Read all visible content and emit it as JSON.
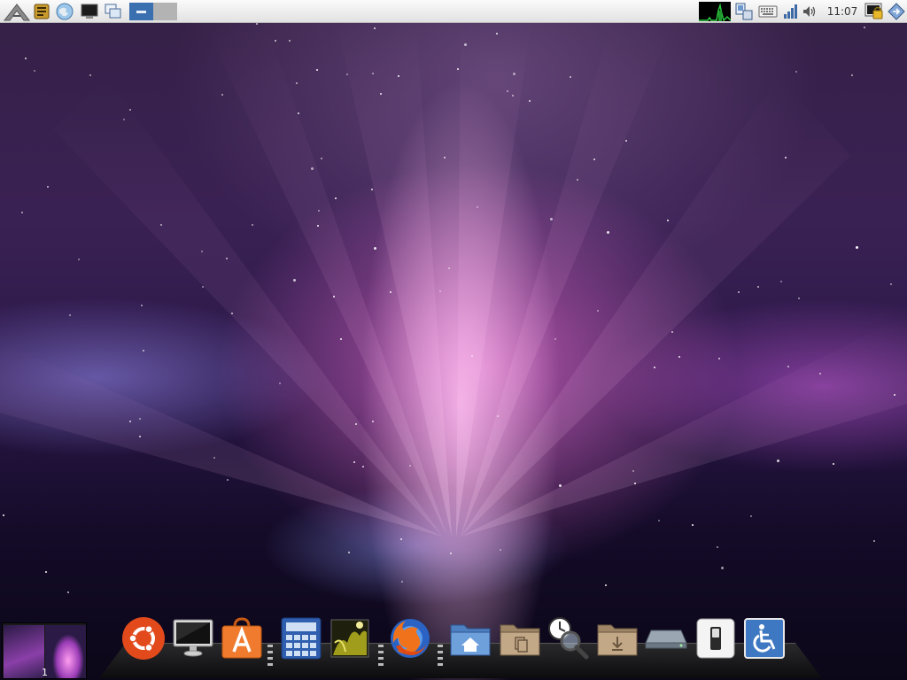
{
  "panel": {
    "clock": "11:07",
    "launchers": [
      {
        "icon": "app-menu-icon"
      },
      {
        "icon": "notes-icon"
      },
      {
        "icon": "web-browser-icon"
      },
      {
        "icon": "terminal-icon"
      },
      {
        "icon": "switch-windows-icon"
      },
      {
        "icon": "show-desktop-icon"
      }
    ],
    "tray": [
      {
        "icon": "cpu-monitor-icon"
      },
      {
        "icon": "network-icon"
      },
      {
        "icon": "keyboard-icon"
      },
      {
        "icon": "signal-icon"
      },
      {
        "icon": "volume-icon"
      },
      {
        "icon": "lock-screen-icon"
      },
      {
        "icon": "logout-icon"
      }
    ]
  },
  "pager": {
    "workspace_number": "1"
  },
  "dock": {
    "items": [
      {
        "icon": "ubuntu-logo-icon",
        "color": "#e24a1c"
      },
      {
        "icon": "monitor-icon",
        "color": "#2b2b2b"
      },
      {
        "icon": "software-center-icon",
        "color": "#f07a2e"
      },
      {
        "icon": "calculator-icon",
        "color": "#3f74c8"
      },
      {
        "icon": "image-viewer-icon",
        "color": "#c8c020"
      },
      {
        "icon": "firefox-icon",
        "color": "#f0731c"
      },
      {
        "icon": "home-folder-icon",
        "color": "#5a8ccd"
      },
      {
        "icon": "documents-folder-icon",
        "color": "#b59a78"
      },
      {
        "icon": "search-clock-icon",
        "color": "#cccccc"
      },
      {
        "icon": "downloads-folder-icon",
        "color": "#b59a78"
      },
      {
        "icon": "drive-icon",
        "color": "#8f98a2"
      },
      {
        "icon": "switch-icon",
        "color": "#eeeeee"
      },
      {
        "icon": "accessibility-icon",
        "color": "#3e77c2"
      }
    ]
  },
  "colors": {
    "panel_bg": "#ececec",
    "accent_pink": "#e86ad2",
    "sky_dark": "#140b28"
  }
}
